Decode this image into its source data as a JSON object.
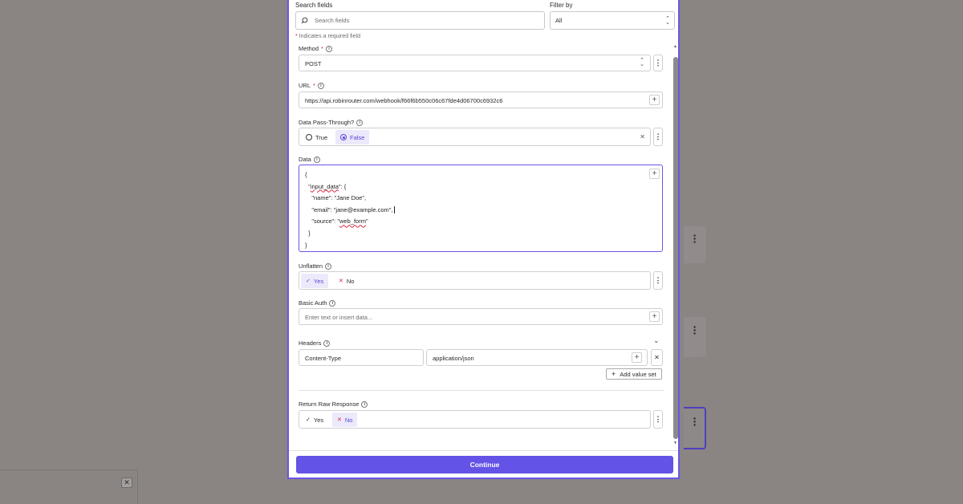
{
  "search": {
    "label": "Search fields",
    "placeholder": "Search fields"
  },
  "filter": {
    "label": "Filter by",
    "value": "All"
  },
  "required_note": {
    "star": "*",
    "text": "Indicates a required field"
  },
  "fields": {
    "method": {
      "label": "Method",
      "required": "*",
      "value": "POST"
    },
    "url": {
      "label": "URL",
      "required": "*",
      "value": "https://api.robinrouter.com/webhook/f66f6b550c06c67fde4d06700c6932c6"
    },
    "passthrough": {
      "label": "Data Pass-Through?",
      "opt_true": "True",
      "opt_false": "False",
      "selected": "False"
    },
    "data": {
      "label": "Data",
      "lines": [
        "{",
        "  \"input_data\": {",
        "    \"name\": \"Jane Doe\",",
        "    \"email\": \"jane@example.com\",",
        "    \"source\": \"web_form\"",
        "  }",
        "}"
      ]
    },
    "unflatten": {
      "label": "Unflatten",
      "yes": "Yes",
      "no": "No",
      "selected": "Yes"
    },
    "basic_auth": {
      "label": "Basic Auth",
      "placeholder": "Enter text or insert data..."
    },
    "headers": {
      "label": "Headers",
      "key": "Content-Type",
      "value": "application/json",
      "add_label": "Add value set"
    },
    "raw_response": {
      "label": "Return Raw Response",
      "yes": "Yes",
      "no": "No",
      "selected": "No"
    }
  },
  "continue_label": "Continue",
  "colors": {
    "accent": "#6353e6",
    "selected_chip_bg": "#ece9fb",
    "required_star": "#d7263d"
  }
}
